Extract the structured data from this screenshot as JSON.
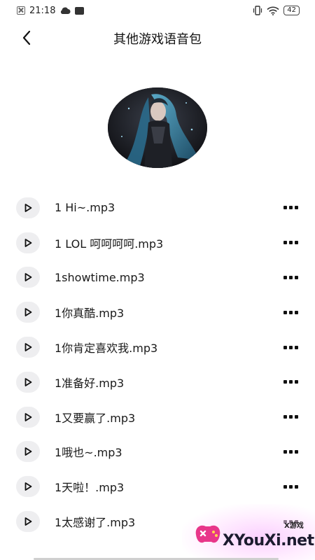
{
  "status_bar": {
    "time": "21:18",
    "battery": "42"
  },
  "header": {
    "title": "其他游戏语音包"
  },
  "sounds": [
    {
      "name": "1 Hi~.mp3"
    },
    {
      "name": "1 LOL 呵呵呵呵.mp3"
    },
    {
      "name": "1showtime.mp3"
    },
    {
      "name": "1你真酷.mp3"
    },
    {
      "name": "1你肯定喜欢我.mp3"
    },
    {
      "name": "1准备好.mp3"
    },
    {
      "name": "1又要赢了.mp3"
    },
    {
      "name": "1哦也~.mp3"
    },
    {
      "name": "1天啦！.mp3"
    },
    {
      "name": "1太感谢了.mp3"
    }
  ],
  "watermark": {
    "brand": "XYouXi.net",
    "tag": "X游戏"
  },
  "colors": {
    "play_button_bg": "#eeeef0",
    "text": "#1a1a1a"
  }
}
